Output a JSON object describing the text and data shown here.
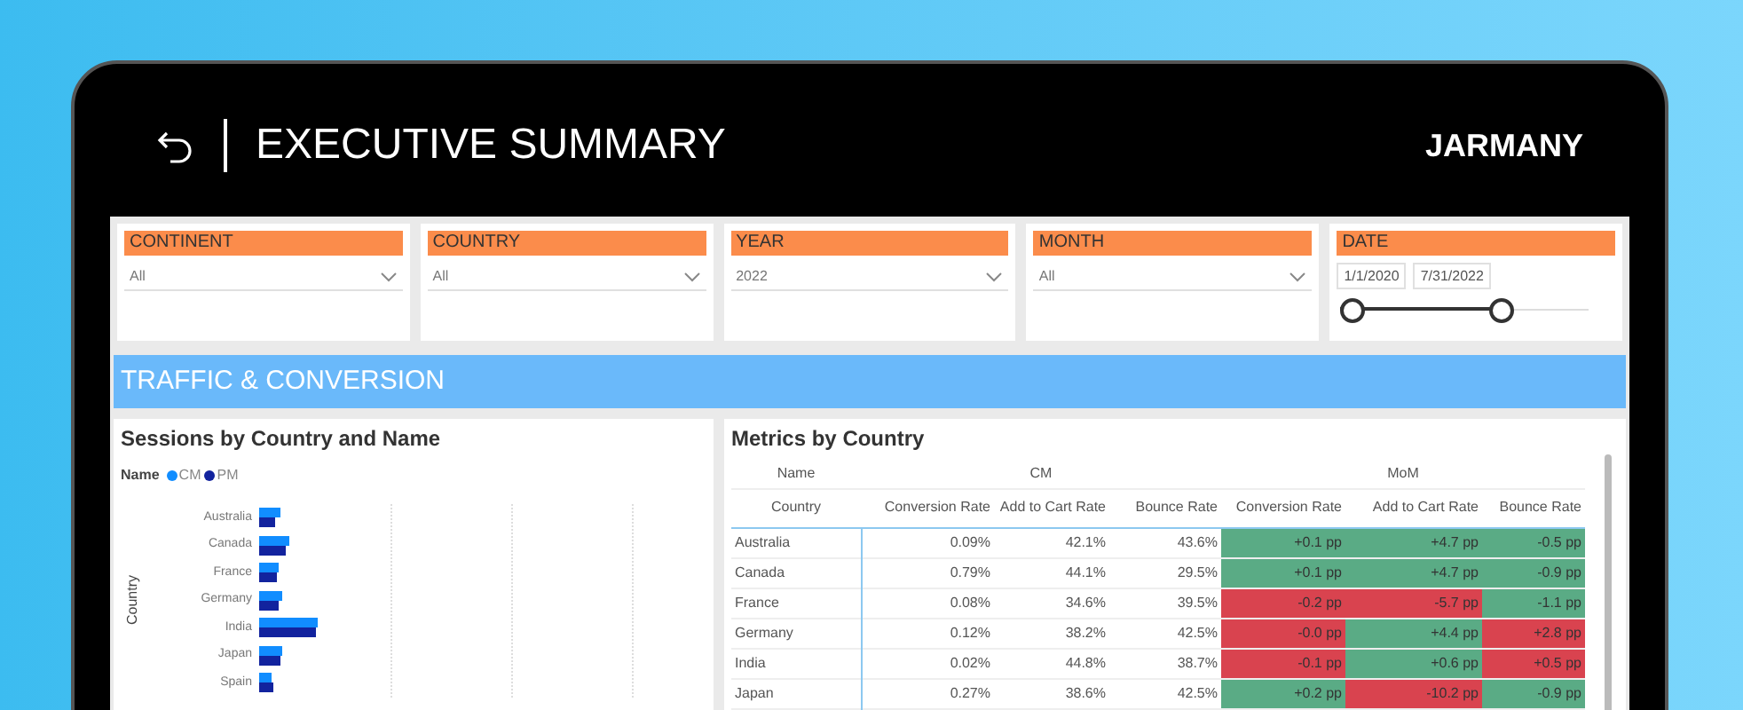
{
  "header": {
    "title": "EXECUTIVE SUMMARY",
    "brand": "JARMANY"
  },
  "filters": [
    {
      "kind": "dropdown",
      "label": "CONTINENT",
      "value": "All"
    },
    {
      "kind": "dropdown",
      "label": "COUNTRY",
      "value": "All"
    },
    {
      "kind": "dropdown",
      "label": "YEAR",
      "value": "2022"
    },
    {
      "kind": "dropdown",
      "label": "MONTH",
      "value": "All"
    },
    {
      "kind": "date_range",
      "label": "DATE",
      "start": "1/1/2020",
      "end": "7/31/2022",
      "thumbs": [
        {
          "level": 0
        },
        {
          "level": 0.65
        }
      ]
    }
  ],
  "section_title": "TRAFFIC & CONVERSION",
  "sessions_chart": {
    "title": "Sessions by Country and Name",
    "legend_title": "Name",
    "legend": [
      {
        "label": "CM",
        "color": "#118dff"
      },
      {
        "label": "PM",
        "color": "#12239e"
      }
    ],
    "axis_title": "Country",
    "countries": [
      "Australia",
      "Canada",
      "France",
      "Germany",
      "India",
      "Japan",
      "Spain"
    ]
  },
  "metrics_table": {
    "title": "Metrics by Country",
    "name_header": "Name",
    "row_header": "Country",
    "groups": [
      {
        "label": "CM",
        "columns": [
          "Conversion Rate",
          "Add to Cart Rate",
          "Bounce Rate"
        ]
      },
      {
        "label": "MoM",
        "columns": [
          "Conversion Rate",
          "Add to Cart Rate",
          "Bounce Rate"
        ]
      }
    ],
    "rows": [
      {
        "country": "Australia",
        "cm": [
          "0.09%",
          "42.1%",
          "43.6%"
        ],
        "mom": [
          {
            "value": "+0.1 pp",
            "color": "#5aab85"
          },
          {
            "value": "+4.7 pp",
            "color": "#5aab85"
          },
          {
            "value": "-0.5 pp",
            "color": "#5aab85"
          }
        ]
      },
      {
        "country": "Canada",
        "cm": [
          "0.79%",
          "44.1%",
          "29.5%"
        ],
        "mom": [
          {
            "value": "+0.1 pp",
            "color": "#5aab85"
          },
          {
            "value": "+4.7 pp",
            "color": "#5aab85"
          },
          {
            "value": "-0.9 pp",
            "color": "#5aab85"
          }
        ]
      },
      {
        "country": "France",
        "cm": [
          "0.08%",
          "34.6%",
          "39.5%"
        ],
        "mom": [
          {
            "value": "-0.2 pp",
            "color": "#d9434f"
          },
          {
            "value": "-5.7 pp",
            "color": "#d9434f"
          },
          {
            "value": "-1.1 pp",
            "color": "#5aab85"
          }
        ]
      },
      {
        "country": "Germany",
        "cm": [
          "0.12%",
          "38.2%",
          "42.5%"
        ],
        "mom": [
          {
            "value": "-0.0 pp",
            "color": "#d9434f"
          },
          {
            "value": "+4.4 pp",
            "color": "#5aab85"
          },
          {
            "value": "+2.8 pp",
            "color": "#d9434f"
          }
        ]
      },
      {
        "country": "India",
        "cm": [
          "0.02%",
          "44.8%",
          "38.7%"
        ],
        "mom": [
          {
            "value": "-0.1 pp",
            "color": "#d9434f"
          },
          {
            "value": "+0.6 pp",
            "color": "#5aab85"
          },
          {
            "value": "+0.5 pp",
            "color": "#d9434f"
          }
        ]
      },
      {
        "country": "Japan",
        "cm": [
          "0.27%",
          "38.6%",
          "42.5%"
        ],
        "mom": [
          {
            "value": "+0.2 pp",
            "color": "#5aab85"
          },
          {
            "value": "-10.2 pp",
            "color": "#d9434f"
          },
          {
            "value": "-0.9 pp",
            "color": "#5aab85"
          }
        ]
      }
    ]
  }
}
